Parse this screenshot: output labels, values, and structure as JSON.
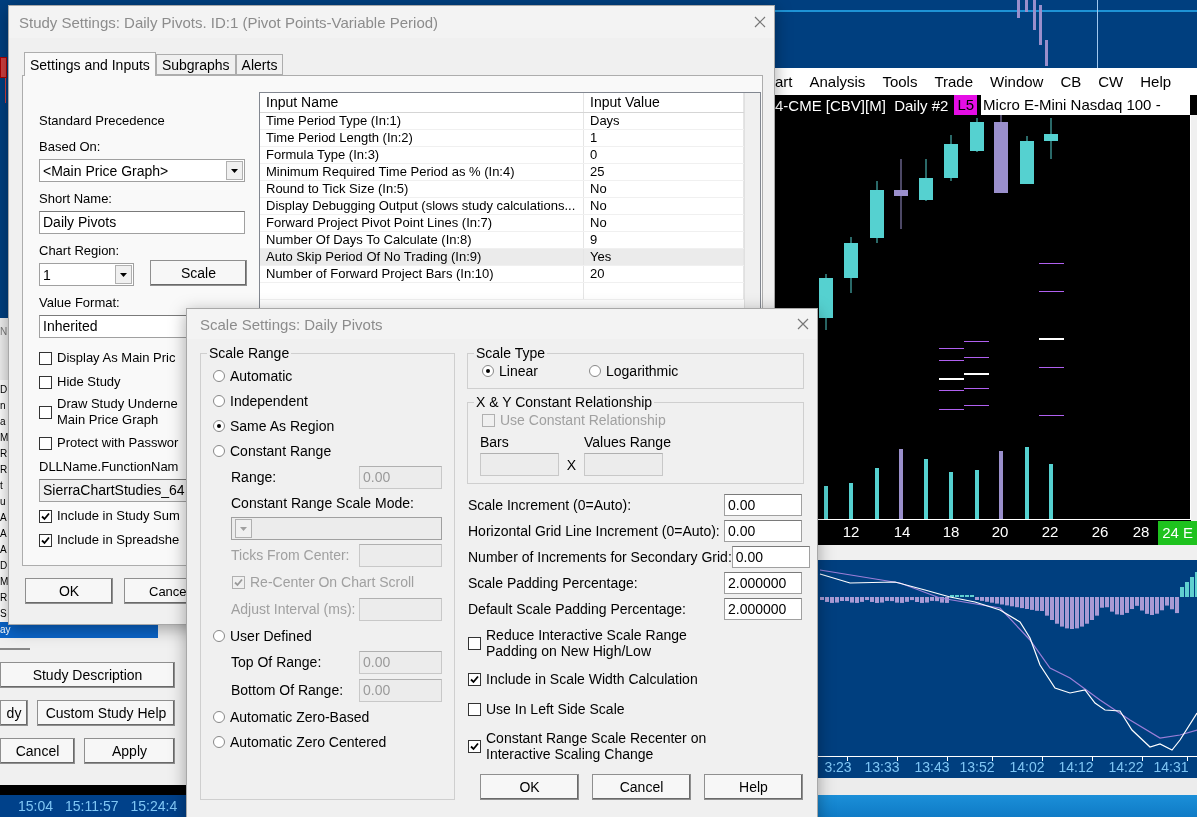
{
  "back_window": {
    "tab_fragment": "N",
    "list_items": [
      {
        "label": "D",
        "selected": false
      },
      {
        "label": "n",
        "selected": false
      },
      {
        "label": "a",
        "selected": false
      },
      {
        "label": "M",
        "selected": false
      },
      {
        "label": "R",
        "selected": false
      },
      {
        "label": "R",
        "selected": false
      },
      {
        "label": "t",
        "selected": false
      },
      {
        "label": "u",
        "selected": false
      },
      {
        "label": "A",
        "selected": false
      },
      {
        "label": "A",
        "selected": false
      },
      {
        "label": "A",
        "selected": false
      },
      {
        "label": "D",
        "selected": false
      },
      {
        "label": "M",
        "selected": false
      },
      {
        "label": "R",
        "selected": false
      },
      {
        "label": "S",
        "selected": false
      },
      {
        "label": "ay",
        "selected": true
      }
    ],
    "buttons": [
      "Study Description",
      "dy",
      "Custom Study Help",
      "Cancel",
      "Apply"
    ],
    "time_labels": [
      "15:04",
      "15:11:57",
      "15:24:4"
    ]
  },
  "chart_window": {
    "menu": [
      "art",
      "Analysis",
      "Tools",
      "Trade",
      "Window",
      "CB",
      "CW",
      "Help"
    ],
    "header": {
      "symbol": "4-CME [CBV][M]  Daily #2",
      "badge": "L5",
      "description": "Micro E-Mini Nasdaq 100 -"
    },
    "x_labels": [
      "12",
      "14",
      "18",
      "20",
      "22",
      "26",
      "28"
    ],
    "end_badge": "24 E"
  },
  "lower_chart": {
    "time_labels": [
      "3:23",
      "13:33",
      "13:43",
      "13:52",
      "14:02",
      "14:12",
      "14:22",
      "14:31"
    ]
  },
  "study_dialog": {
    "title": "Study Settings: Daily Pivots. ID:1 (Pivot Points-Variable Period)",
    "tabs": [
      {
        "label": "Settings and Inputs",
        "selected": true
      },
      {
        "label": "Subgraphs",
        "selected": false
      },
      {
        "label": "Alerts",
        "selected": false
      }
    ],
    "precedence_label": "Standard Precedence",
    "based_on": {
      "label": "Based On:",
      "value": "<Main Price Graph>"
    },
    "short_name": {
      "label": "Short Name:",
      "value": "Daily Pivots"
    },
    "chart_region": {
      "label": "Chart Region:",
      "value": "1",
      "button": "Scale"
    },
    "value_format": {
      "label": "Value Format:",
      "value": "Inherited"
    },
    "options": [
      {
        "label": "Display As Main Pric",
        "checked": false
      },
      {
        "label": "Hide Study",
        "checked": false
      },
      {
        "label": "Draw Study Underne\nMain Price Graph",
        "checked": false
      },
      {
        "label": "Protect with Passwor",
        "checked": false
      }
    ],
    "dll": {
      "label": "DLLName.FunctionNam",
      "value": "SierraChartStudies_64",
      "read_only": true
    },
    "options2": [
      {
        "label": "Include in Study Sum",
        "checked": true
      },
      {
        "label": "Include in Spreadshe",
        "checked": true
      }
    ],
    "inputs_table": {
      "columns": [
        "Input Name",
        "Input Value"
      ],
      "rows": [
        {
          "name": "Time Period Type  (In:1)",
          "value": "Days",
          "selected": false
        },
        {
          "name": "Time Period Length  (In:2)",
          "value": "1",
          "selected": false
        },
        {
          "name": "Formula Type  (In:3)",
          "value": "0",
          "selected": false
        },
        {
          "name": "Minimum Required Time Period as %  (In:4)",
          "value": "25",
          "selected": false
        },
        {
          "name": "Round to Tick Size  (In:5)",
          "value": "No",
          "selected": false
        },
        {
          "name": "Display Debugging Output (slows study calculations...",
          "value": "No",
          "selected": false
        },
        {
          "name": "Forward Project Pivot Point Lines  (In:7)",
          "value": "No",
          "selected": false
        },
        {
          "name": "Number Of Days To Calculate  (In:8)",
          "value": "9",
          "selected": false
        },
        {
          "name": "Auto Skip Period Of No Trading  (In:9)",
          "value": "Yes",
          "selected": true
        },
        {
          "name": "Number of Forward Project Bars  (In:10)",
          "value": "20",
          "selected": false
        }
      ]
    },
    "buttons": [
      "OK",
      "Cance"
    ]
  },
  "scale_dialog": {
    "title": "Scale Settings: Daily Pivots",
    "scale_range": {
      "legend": "Scale Range",
      "items": [
        {
          "kind": "radio",
          "label": "Automatic",
          "selected": false
        },
        {
          "kind": "radio",
          "label": "Independent",
          "selected": false
        },
        {
          "kind": "radio",
          "label": "Same As Region",
          "selected": true
        },
        {
          "kind": "radio",
          "label": "Constant Range",
          "selected": false
        },
        {
          "kind": "field",
          "label": "Range:",
          "value": "0.00",
          "label_disabled": false,
          "disabled": true
        },
        {
          "kind": "label",
          "label": "Constant Range Scale Mode:"
        },
        {
          "kind": "select",
          "disabled": true
        },
        {
          "kind": "field",
          "label": "Ticks From Center:",
          "label_disabled": true,
          "disabled": true
        },
        {
          "kind": "checkbox",
          "label": "Re-Center On Chart Scroll",
          "checked": true,
          "disabled": true
        },
        {
          "kind": "field",
          "label": "Adjust Interval (ms):",
          "label_disabled": true,
          "disabled": true
        },
        {
          "kind": "radio",
          "label": "User Defined",
          "selected": false
        },
        {
          "kind": "field",
          "label": "Top Of Range:",
          "value": "0.00",
          "label_disabled": false,
          "disabled": true
        },
        {
          "kind": "field",
          "label": "Bottom Of Range:",
          "value": "0.00",
          "label_disabled": false,
          "disabled": true
        },
        {
          "kind": "radio",
          "label": "Automatic Zero-Based",
          "selected": false
        },
        {
          "kind": "radio",
          "label": "Automatic Zero Centered",
          "selected": false
        }
      ]
    },
    "scale_type": {
      "legend": "Scale Type",
      "options": [
        {
          "label": "Linear",
          "selected": true
        },
        {
          "label": "Logarithmic",
          "selected": false
        }
      ]
    },
    "xy_relationship": {
      "legend": "X & Y Constant Relationship",
      "checkbox": {
        "label": "Use Constant Relationship",
        "checked": false,
        "disabled": true
      },
      "bars_label": "Bars",
      "separator": "X",
      "values_label": "Values Range",
      "inputs_disabled": true
    },
    "numeric_fields": [
      {
        "label": "Scale Increment (0=Auto):",
        "value": "0.00"
      },
      {
        "label": "Horizontal Grid Line Increment (0=Auto):",
        "value": "0.00"
      },
      {
        "label": "Number of Increments for Secondary Grid:",
        "value": "0.00"
      },
      {
        "label": "Scale Padding Percentage:",
        "value": "2.000000"
      },
      {
        "label": "Default Scale Padding Percentage:",
        "value": "2.000000"
      }
    ],
    "options": [
      {
        "label": "Reduce Interactive Scale Range\nPadding on New High/Low",
        "checked": false
      },
      {
        "label": "Include in Scale Width Calculation",
        "checked": true
      },
      {
        "label": "Use In Left Side Scale",
        "checked": false
      },
      {
        "label": "Constant Range Scale Recenter on\nInteractive Scaling Change",
        "checked": true
      }
    ],
    "buttons": [
      "OK",
      "Cancel",
      "Help"
    ]
  }
}
